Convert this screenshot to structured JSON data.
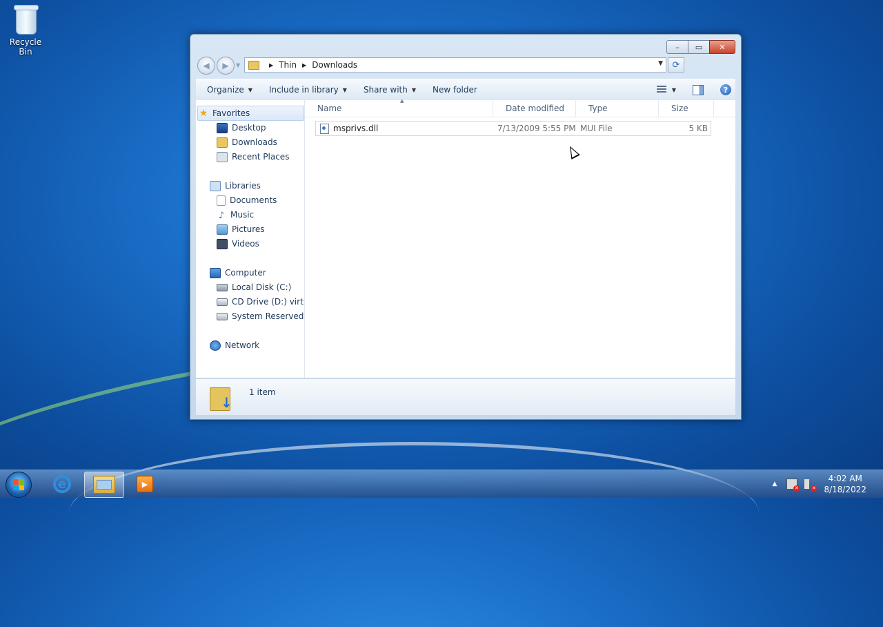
{
  "desktop": {
    "icons": [
      {
        "label": "Recycle Bin",
        "icon": "recycle-bin-icon"
      }
    ]
  },
  "window": {
    "caption": {
      "minimize": "–",
      "maximize": "▭",
      "close": "✕"
    },
    "address": {
      "crumbs": [
        "Thin",
        "Downloads"
      ],
      "dropdown": "▼",
      "refresh": "⟳"
    },
    "toolbar": {
      "organize": "Organize",
      "include_in_library": "Include in library",
      "share_with": "Share with",
      "new_folder": "New folder",
      "help": "?"
    },
    "nav": {
      "favorites": {
        "label": "Favorites",
        "items": [
          "Desktop",
          "Downloads",
          "Recent Places"
        ]
      },
      "libraries": {
        "label": "Libraries",
        "items": [
          "Documents",
          "Music",
          "Pictures",
          "Videos"
        ]
      },
      "computer": {
        "label": "Computer",
        "items": [
          "Local Disk (C:)",
          "CD Drive (D:) virtio-v",
          "System Reserved (E:)"
        ]
      },
      "network": {
        "label": "Network"
      }
    },
    "columns": [
      "Name",
      "Date modified",
      "Type",
      "Size"
    ],
    "files": [
      {
        "name": "msprivs.dll",
        "date_modified": "7/13/2009 5:55 PM",
        "type": "MUI File",
        "size": "5 KB"
      }
    ],
    "details": {
      "item_count": "1 item"
    }
  },
  "taskbar": {
    "clock_time": "4:02 AM",
    "clock_date": "8/18/2022",
    "tray_expand": "▲"
  }
}
